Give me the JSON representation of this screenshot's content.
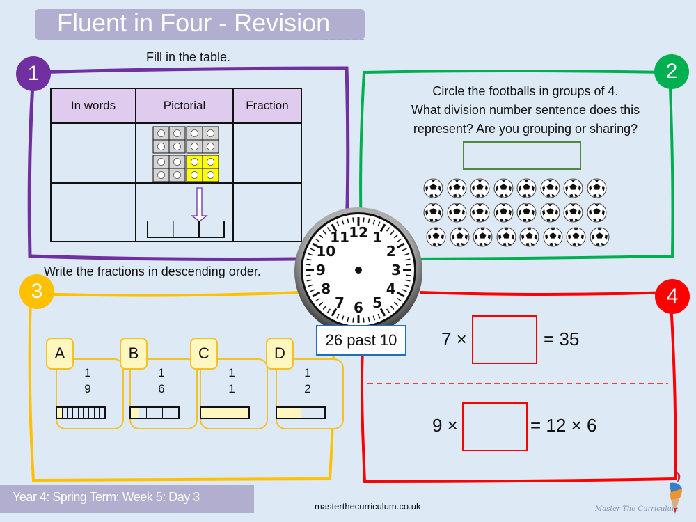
{
  "header": {
    "title": "Fluent in Four - Revision"
  },
  "questions": {
    "q1": {
      "number": "1",
      "color": "#7030a0",
      "instruction": "Fill in the table.",
      "table": {
        "headers": [
          "In words",
          "Pictorial",
          "Fraction"
        ],
        "rows": [
          {
            "in_words": "",
            "pictorial": "ten-frame-blocks-4-of-16-yellow",
            "fraction": ""
          },
          {
            "in_words": "",
            "pictorial": "number-line-arrow-at-2-of-3",
            "fraction": ""
          }
        ]
      }
    },
    "q2": {
      "number": "2",
      "color": "#00b050",
      "instruction_lines": [
        "Circle the footballs in groups of 4.",
        "What division number sentence does this",
        "represent? Are you grouping or sharing?"
      ],
      "answer_value": "",
      "football_rows": 3,
      "football_cols": 8,
      "football_count": 24
    },
    "q3": {
      "number": "3",
      "color": "#ffc000",
      "instruction": "Write the fractions in descending order.",
      "cards": [
        {
          "label": "A",
          "numerator": "1",
          "denominator": "9",
          "parts": 9,
          "filled": 1
        },
        {
          "label": "B",
          "numerator": "1",
          "denominator": "6",
          "parts": 6,
          "filled": 1
        },
        {
          "label": "C",
          "numerator": "1",
          "denominator": "1",
          "parts": 1,
          "filled": 1
        },
        {
          "label": "D",
          "numerator": "1",
          "denominator": "2",
          "parts": 2,
          "filled": 1
        }
      ]
    },
    "q4": {
      "number": "4",
      "color": "#ff0000",
      "equations": [
        {
          "left": "7 ×",
          "right": "= 35",
          "answer": ""
        },
        {
          "left": "9 ×",
          "right": "= 12 × 6",
          "answer": ""
        }
      ]
    }
  },
  "clock": {
    "numerals": [
      "12",
      "1",
      "2",
      "3",
      "4",
      "5",
      "6",
      "7",
      "8",
      "9",
      "10",
      "11"
    ],
    "caption": "26 past 10"
  },
  "footer": {
    "lesson": "Year 4: Spring Term: Week 5: Day 3",
    "url": "masterthecurriculum.co.uk",
    "brand": "Master  The  Curriculum"
  }
}
